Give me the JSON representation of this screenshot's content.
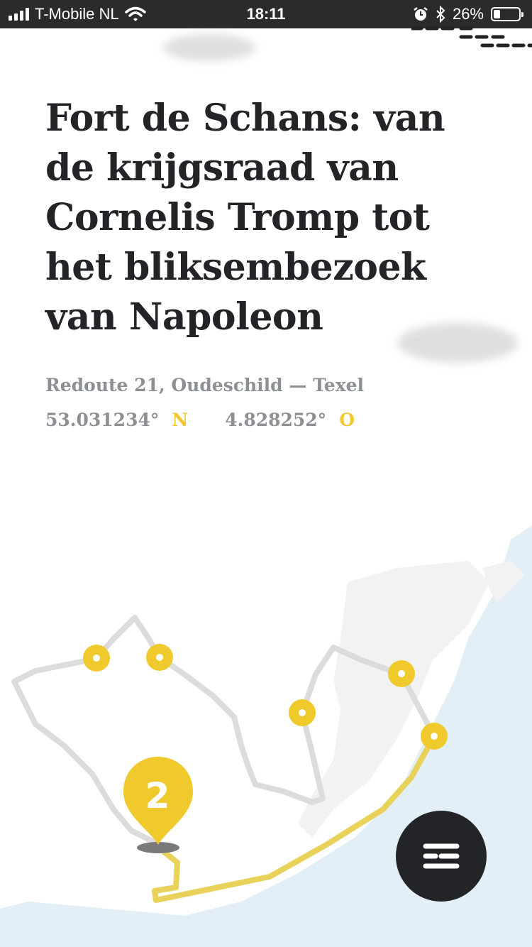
{
  "status_bar": {
    "carrier": "T-Mobile NL",
    "time": "18:11",
    "battery_percent": "26%",
    "battery_level": 0.26,
    "icons": [
      "signal-icon",
      "wifi-icon",
      "alarm-icon",
      "bluetooth-icon",
      "battery-icon"
    ]
  },
  "location": {
    "title": "Fort de Schans: van de krijgsraad van Cornelis Tromp tot het bliksembezoek van Napoleon",
    "address": "Redoute 21, Oudeschild — Texel",
    "latitude": "53.031234°",
    "latitude_dir": "N",
    "longitude": "4.828252°",
    "longitude_dir": "O"
  },
  "map": {
    "active_marker_number": "2",
    "marker_count": 6,
    "colors": {
      "accent": "#f0c92c",
      "route_active": "#e8d25a",
      "route_inactive": "#dcdcdc",
      "water": "#e2eff6",
      "land_block": "#f2f2f2"
    }
  },
  "menu_button": {
    "icon": "menu-icon",
    "color": "#222428"
  }
}
